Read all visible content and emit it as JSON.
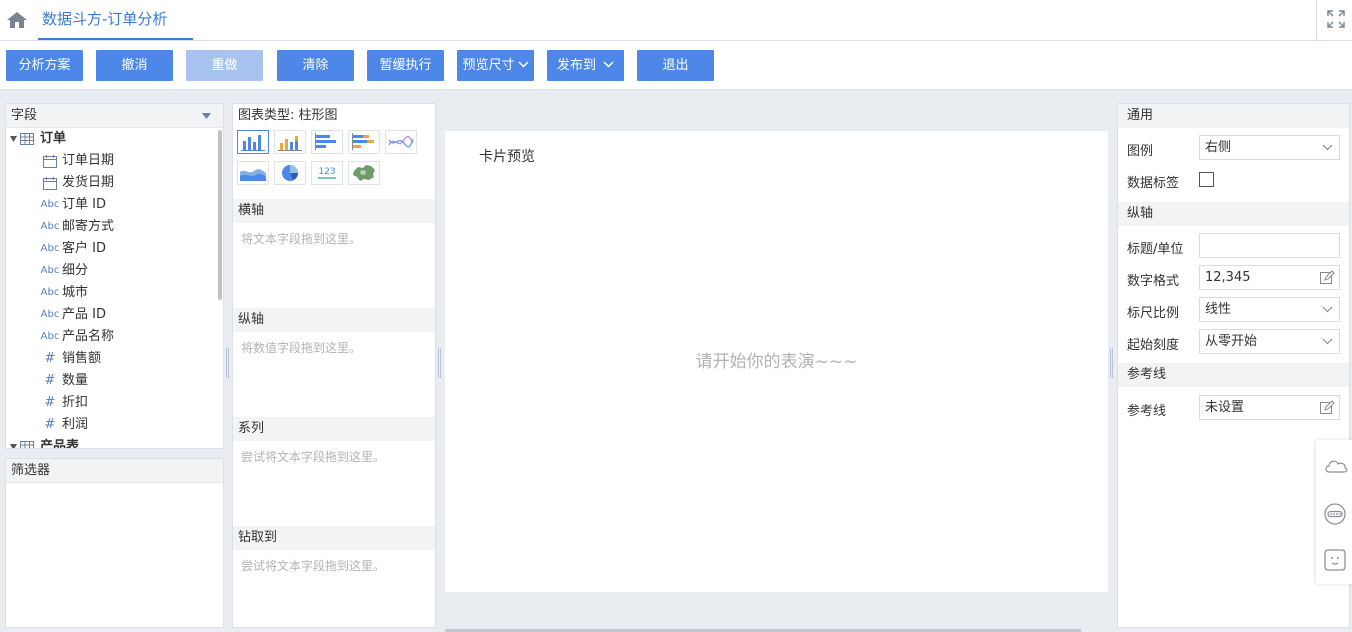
{
  "header": {
    "tab_title": "数据斗方-订单分析"
  },
  "toolbar": {
    "buttons": [
      {
        "label": "分析方案"
      },
      {
        "label": "撤消"
      },
      {
        "label": "重做"
      },
      {
        "label": "清除"
      },
      {
        "label": "暂缓执行"
      },
      {
        "label": "预览尺寸"
      },
      {
        "label": "发布到"
      },
      {
        "label": "退出"
      }
    ]
  },
  "fields_panel": {
    "title": "字段",
    "group": "订单",
    "items": [
      {
        "type": "date",
        "label": "订单日期"
      },
      {
        "type": "text",
        "label": "发货日期"
      },
      {
        "type": "text",
        "label": "订单 ID"
      },
      {
        "type": "text",
        "label": "邮寄方式"
      },
      {
        "type": "text",
        "label": "客户 ID"
      },
      {
        "type": "text",
        "label": "细分"
      },
      {
        "type": "text",
        "label": "城市"
      },
      {
        "type": "text",
        "label": "产品 ID"
      },
      {
        "type": "text",
        "label": "产品名称"
      },
      {
        "type": "number",
        "label": "销售额"
      },
      {
        "type": "number",
        "label": "数量"
      },
      {
        "type": "number",
        "label": "折扣"
      },
      {
        "type": "number",
        "label": "利润"
      }
    ],
    "next_group_partial": "产品表",
    "icon_text": {
      "text": "Abc",
      "number": "#"
    }
  },
  "filters_panel": {
    "title": "筛选器"
  },
  "chart_config": {
    "type_label": "图表类型: 柱形图",
    "zones": [
      {
        "title": "横轴",
        "hint": "将文本字段拖到这里。"
      },
      {
        "title": "纵轴",
        "hint": "将数值字段拖到这里。"
      },
      {
        "title": "系列",
        "hint": "尝试将文本字段拖到这里。"
      },
      {
        "title": "钻取到",
        "hint": "尝试将文本字段拖到这里。"
      }
    ],
    "number_icon_text": "123"
  },
  "canvas": {
    "card_title": "卡片预览",
    "placeholder": "请开始你的表演~~~"
  },
  "properties": {
    "general_section": "通用",
    "legend_label": "图例",
    "legend_value": "右侧",
    "data_label_label": "数据标签",
    "axis_section": "纵轴",
    "title_unit_label": "标题/单位",
    "title_unit_value": "",
    "number_format_label": "数字格式",
    "number_format_value": "12,345",
    "scale_label": "标尺比例",
    "scale_value": "线性",
    "start_label": "起始刻度",
    "start_value": "从零开始",
    "refline_section": "参考线",
    "refline_label": "参考线",
    "refline_value": "未设置"
  },
  "colors": {
    "accent": "#4d88e8",
    "accent_disabled": "#a8c3ef",
    "tab_blue": "#3b7bd8"
  }
}
